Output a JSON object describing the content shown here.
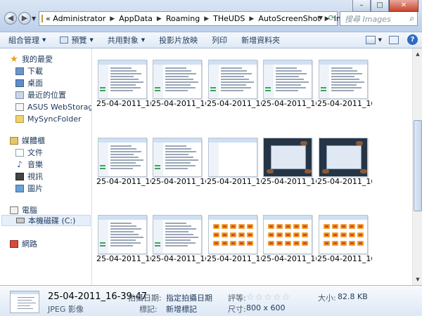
{
  "window": {
    "breadcrumb": [
      "«",
      "Administrator",
      "AppData",
      "Roaming",
      "THeUDS",
      "AutoScreenShot",
      "Images"
    ],
    "search_placeholder": "搜尋 Images",
    "buttons": {
      "minimize": "–",
      "maximize": "□",
      "close": "✕"
    }
  },
  "toolbar": {
    "organize": "組合管理",
    "preview": "預覽",
    "share": "共用對象",
    "slideshow": "投影片放映",
    "print": "列印",
    "new_folder": "新增資料夾"
  },
  "nav": {
    "favorites": "我的最愛",
    "downloads": "下載",
    "desktop": "桌面",
    "recent": "最近的位置",
    "asus": "ASUS WebStorage Dr",
    "mysync": "MySyncFolder",
    "libraries": "媒體櫃",
    "documents": "文件",
    "music": "音樂",
    "videos": "視訊",
    "pictures": "圖片",
    "computer": "電腦",
    "local_disk": "本機磁碟 (C:)",
    "network": "網路"
  },
  "files": [
    {
      "label": "25-04-2011_16-...",
      "kind": "screen"
    },
    {
      "label": "25-04-2011_16-...",
      "kind": "screen"
    },
    {
      "label": "25-04-2011_16-...",
      "kind": "screen"
    },
    {
      "label": "25-04-2011_16-...",
      "kind": "screen"
    },
    {
      "label": "25-04-2011_16-...",
      "kind": "screen"
    },
    {
      "label": "25-04-2011_16-...",
      "kind": "screen"
    },
    {
      "label": "25-04-2011_16-...",
      "kind": "screen"
    },
    {
      "label": "25-04-2011_16-...",
      "kind": "blank"
    },
    {
      "label": "25-04-2011_16-...",
      "kind": "dark"
    },
    {
      "label": "25-04-2011_16-...",
      "kind": "dark"
    },
    {
      "label": "25-04-2011_16-...",
      "kind": "screen"
    },
    {
      "label": "25-04-2011_16-...",
      "kind": "screen"
    },
    {
      "label": "25-04-2011_16-...",
      "kind": "cards"
    },
    {
      "label": "25-04-2011_16-...",
      "kind": "cards"
    },
    {
      "label": "25-04-2011_16-...",
      "kind": "cards"
    }
  ],
  "details": {
    "name": "25-04-2011_16-39-47",
    "type": "JPEG 影像",
    "date_taken_label": "拍攝日期:",
    "date_taken_value": "指定拍攝日期",
    "tags_label": "標記:",
    "tags_value": "新增標記",
    "rating_label": "評等:",
    "rating_stars": "☆☆☆☆☆",
    "rating_value": 0,
    "dimensions_label": "尺寸:",
    "dimensions_value": "800 x 600",
    "size_label": "大小:",
    "size_value": "82.8 KB"
  },
  "colors": {
    "accent": "#1e395b",
    "selection": "#e5eef9"
  }
}
